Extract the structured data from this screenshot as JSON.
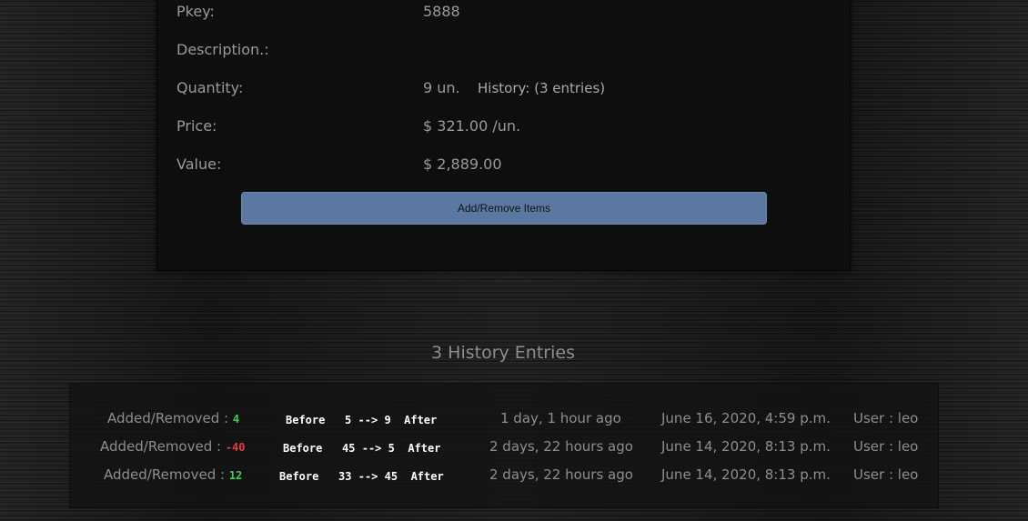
{
  "details": {
    "pkey": {
      "label": "Pkey:",
      "value": "5888"
    },
    "description": {
      "label": "Description.:",
      "value": ""
    },
    "quantity": {
      "label": "Quantity:",
      "value": "9 un.",
      "history_link": "History: (3 entries)"
    },
    "price": {
      "label": "Price:",
      "value": "$ 321.00 /un."
    },
    "value": {
      "label": "Value:",
      "value": "$ 2,889.00"
    }
  },
  "actions": {
    "add_remove_label": "Add/Remove Items"
  },
  "history": {
    "title": "3 History Entries",
    "entries": [
      {
        "change_label": "Added/Removed : ",
        "delta": "4",
        "before_label": "Before",
        "before": "5",
        "arrow": "-->",
        "after": "9",
        "after_label": "After",
        "relative_time": "1 day, 1 hour ago",
        "date": "June 16, 2020, 4:59 p.m.",
        "user": "User : leo"
      },
      {
        "change_label": "Added/Removed : ",
        "delta": "-40",
        "before_label": "Before",
        "before": "45",
        "arrow": "-->",
        "after": "5",
        "after_label": "After",
        "relative_time": "2 days, 22 hours ago",
        "date": "June 14, 2020, 8:13 p.m.",
        "user": "User : leo"
      },
      {
        "change_label": "Added/Removed : ",
        "delta": "12",
        "before_label": "Before",
        "before": "33",
        "arrow": "-->",
        "after": "45",
        "after_label": "After",
        "relative_time": "2 days, 22 hours ago",
        "date": "June 14, 2020, 8:13 p.m.",
        "user": "User : leo"
      }
    ]
  },
  "colors": {
    "positive": "#3fcf53",
    "negative": "#e83c3c",
    "button": "#5b79a0"
  }
}
